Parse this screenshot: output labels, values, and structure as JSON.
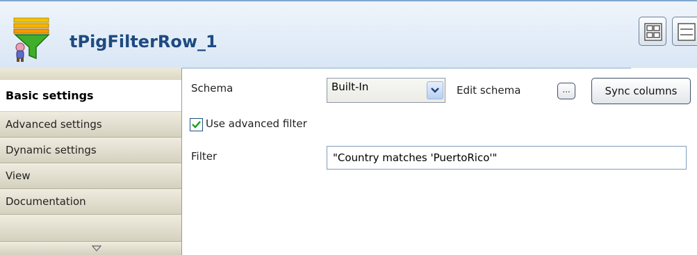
{
  "header": {
    "title": "tPigFilterRow_1",
    "component_icon": "filter-funnel-icon",
    "buttons": [
      {
        "icon": "grid-layout-icon"
      },
      {
        "icon": "list-layout-icon"
      }
    ]
  },
  "tabs": {
    "items": [
      {
        "label": "Basic settings",
        "active": true
      },
      {
        "label": "Advanced settings",
        "active": false
      },
      {
        "label": "Dynamic settings",
        "active": false
      },
      {
        "label": "View",
        "active": false
      },
      {
        "label": "Documentation",
        "active": false
      }
    ],
    "scroll_icon": "chevron-down-icon"
  },
  "form": {
    "schema_label": "Schema",
    "schema_value": "Built-In",
    "edit_schema_label": "Edit schema",
    "edit_schema_button": "...",
    "sync_columns_button": "Sync columns",
    "use_advanced_filter_label": "Use advanced filter",
    "use_advanced_filter_checked": true,
    "filter_label": "Filter",
    "filter_value": "\"Country matches 'PuertoRico'\""
  },
  "colors": {
    "title": "#1e4a80",
    "header_bg": "#e3edf8",
    "tab_bg": "#e2dfd0"
  }
}
